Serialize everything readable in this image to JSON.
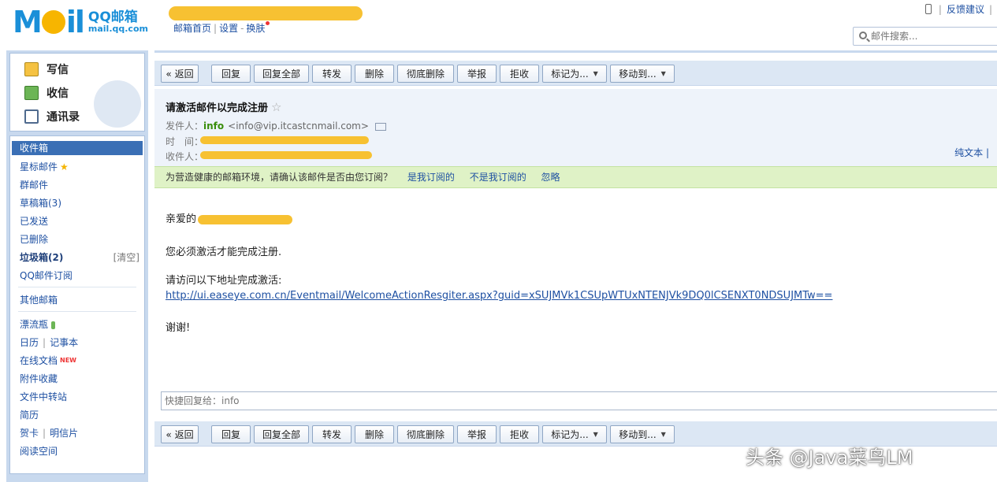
{
  "header": {
    "brand": "QQ邮箱",
    "brand_domain": "mail.qq.com",
    "nav": [
      "邮箱首页",
      "设置",
      "换肤"
    ],
    "feedback": "反馈建议",
    "search_placeholder": "邮件搜索..."
  },
  "quick_actions": [
    "写信",
    "收信",
    "通讯录"
  ],
  "folders": {
    "inbox": "收件箱",
    "starred": "星标邮件",
    "group": "群邮件",
    "drafts": "草稿箱(3)",
    "sent": "已发送",
    "deleted": "已删除",
    "spam": "垃圾箱(2)",
    "spam_clear": "[清空]",
    "subscriptions": "QQ邮件订阅",
    "other_mailbox": "其他邮箱",
    "drift_bottle": "漂流瓶",
    "calendar": "日历",
    "notebook": "记事本",
    "online_docs": "在线文档",
    "new_badge": "NEW",
    "attachments": "附件收藏",
    "file_transfer": "文件中转站",
    "resume": "简历",
    "greeting_card": "贺卡",
    "postcard": "明信片",
    "reading_space": "阅读空间"
  },
  "toolbar": {
    "back": "« 返回",
    "reply": "回复",
    "reply_all": "回复全部",
    "forward": "转发",
    "delete": "删除",
    "delete_permanently": "彻底删除",
    "report": "举报",
    "reject": "拒收",
    "mark_as": "标记为...",
    "move_to": "移动到..."
  },
  "mail": {
    "subject": "请激活邮件以完成注册",
    "sender_label": "发件人：",
    "sender_name": "info",
    "sender_address": "<info@vip.itcastcnmail.com>",
    "time_label": "时　间：",
    "recipient_label": "收件人：",
    "plain_text": "纯文本",
    "notice": "为营造健康的邮箱环境，请确认该邮件是否由您订阅？",
    "notice_yes": "是我订阅的",
    "notice_no": "不是我订阅的",
    "notice_ignore": "忽略",
    "greeting": "亲爱的",
    "line1": "您必须激活才能完成注册.",
    "line2": "请访问以下地址完成激活:",
    "link": "http://ui.easeye.com.cn/Eventmail/WelcomeActionResgiter.aspx?guid=xSUJMVk1CSUpWTUxNTENJVk9DQ0lCSENXT0NDSUJMTw==",
    "sign_off": "谢谢!",
    "quick_reply_placeholder": "快捷回复给：info"
  },
  "watermark": "头条 @Java菜鸟LM",
  "colors": {
    "brand_blue": "#1a8fd8",
    "link_blue": "#1e50a2",
    "toolbar_bg": "#dce7f4",
    "notice_bg": "#dff2c6",
    "sender_green": "#398d0b"
  }
}
